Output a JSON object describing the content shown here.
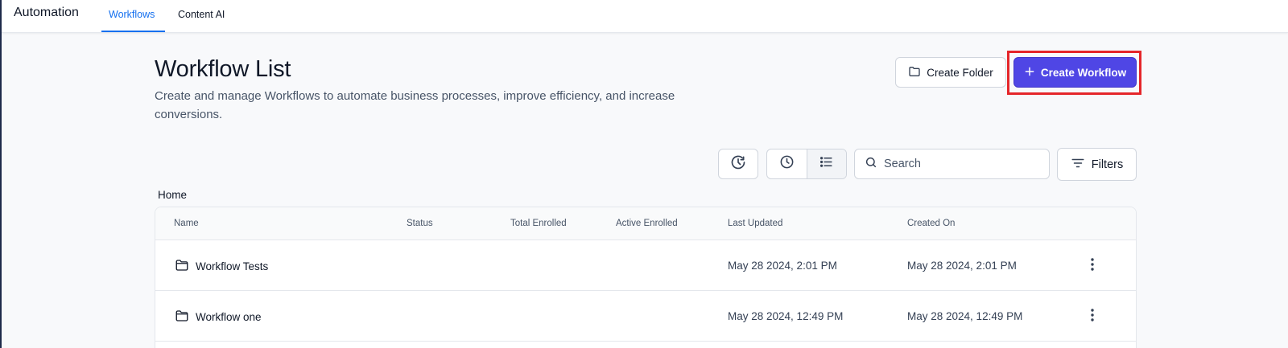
{
  "app": {
    "title": "Automation"
  },
  "nav": {
    "tabs": [
      {
        "label": "Workflows",
        "active": true
      },
      {
        "label": "Content AI",
        "active": false
      }
    ]
  },
  "header": {
    "title": "Workflow List",
    "description": "Create and manage Workflows to automate business processes, improve efficiency, and increase conversions.",
    "create_folder_label": "Create Folder",
    "create_workflow_label": "Create Workflow"
  },
  "toolbar": {
    "search_placeholder": "Search",
    "filters_label": "Filters",
    "icons": [
      "history-icon",
      "clock-icon",
      "list-view-icon",
      "search-icon",
      "filter-icon"
    ]
  },
  "breadcrumb": {
    "current": "Home"
  },
  "table": {
    "columns": [
      "Name",
      "Status",
      "Total Enrolled",
      "Active Enrolled",
      "Last Updated",
      "Created On"
    ],
    "rows": [
      {
        "name": "Workflow Tests",
        "status": "",
        "total_enrolled": "",
        "active_enrolled": "",
        "last_updated": "May 28 2024, 2:01 PM",
        "created_on": "May 28 2024, 2:01 PM"
      },
      {
        "name": "Workflow one",
        "status": "",
        "total_enrolled": "",
        "active_enrolled": "",
        "last_updated": "May 28 2024, 12:49 PM",
        "created_on": "May 28 2024, 12:49 PM"
      }
    ]
  },
  "colors": {
    "primary": "#4f46e5",
    "highlight": "#e5262a",
    "active_tab": "#1570ef"
  }
}
